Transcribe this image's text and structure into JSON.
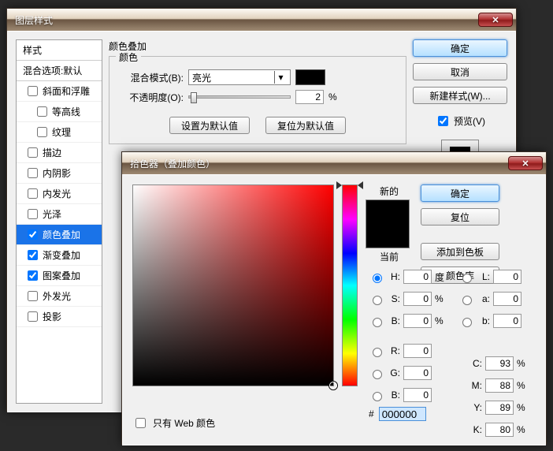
{
  "layer_style": {
    "title": "图层样式",
    "ok": "确定",
    "cancel": "取消",
    "new_style": "新建样式(W)...",
    "preview": "预览(V)",
    "styles_header": "样式",
    "blending_options": "混合选项:默认",
    "items": [
      {
        "label": "斜面和浮雕",
        "checked": false
      },
      {
        "label": "等高线",
        "checked": false,
        "indent": true
      },
      {
        "label": "纹理",
        "checked": false,
        "indent": true
      },
      {
        "label": "描边",
        "checked": false
      },
      {
        "label": "内阴影",
        "checked": false
      },
      {
        "label": "内发光",
        "checked": false
      },
      {
        "label": "光泽",
        "checked": false
      },
      {
        "label": "颜色叠加",
        "checked": true,
        "selected": true
      },
      {
        "label": "渐变叠加",
        "checked": true
      },
      {
        "label": "图案叠加",
        "checked": true
      },
      {
        "label": "外发光",
        "checked": false
      },
      {
        "label": "投影",
        "checked": false
      }
    ],
    "section_title": "颜色叠加",
    "group_title": "颜色",
    "blend_mode_label": "混合模式(B):",
    "blend_mode_value": "亮光",
    "opacity_label": "不透明度(O):",
    "opacity_value": "2",
    "opacity_unit": "%",
    "set_default": "设置为默认值",
    "reset_default": "复位为默认值",
    "overlay_color": "#000000"
  },
  "color_picker": {
    "title": "拾色器（叠加颜色）",
    "ok": "确定",
    "reset": "复位",
    "add_swatch": "添加到色板",
    "color_lib": "颜色库",
    "new_label": "新的",
    "current_label": "当前",
    "new_color": "#000000",
    "current_color": "#000000",
    "H": "0",
    "H_unit": "度",
    "S": "0",
    "S_unit": "%",
    "Bv": "0",
    "Bv_unit": "%",
    "R": "0",
    "G": "0",
    "Bc": "0",
    "L": "0",
    "a": "0",
    "b": "0",
    "C": "93",
    "M": "88",
    "Y": "89",
    "K": "80",
    "hex_prefix": "#",
    "hex": "000000",
    "web_only": "只有 Web 颜色",
    "percent": "%"
  }
}
